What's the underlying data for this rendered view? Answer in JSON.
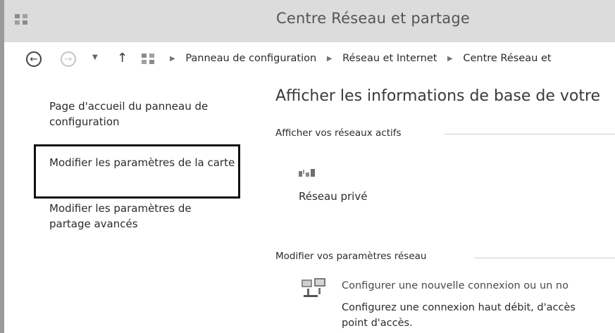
{
  "window": {
    "title": "Centre Réseau et partage"
  },
  "navbar": {
    "breadcrumb": [
      "Panneau de configuration",
      "Réseau et Internet",
      "Centre Réseau et"
    ]
  },
  "left_pane": {
    "links": [
      "Page d'accueil du panneau de configuration",
      "Modifier les paramètres de la carte",
      "Modifier les paramètres de partage avancés"
    ]
  },
  "main": {
    "heading": "Afficher les informations de base de votre",
    "active_networks": {
      "title": "Afficher vos réseaux actifs",
      "network_label": "Réseau privé"
    },
    "modify_settings": {
      "title": "Modifier vos paramètres réseau",
      "tasks": [
        {
          "label": "Configurer une nouvelle connexion ou un no",
          "description_line1": "Configurez une connexion haut débit, d'accès",
          "description_line2": "point d'accès."
        }
      ]
    }
  },
  "icons": {
    "title": "control-panel-icon",
    "back": "back-arrow-icon",
    "forward": "forward-arrow-icon",
    "up": "up-arrow-icon",
    "network": "network-icon",
    "new_connection": "new-connection-icon"
  },
  "colors": {
    "titlebar": "#dcdcdc",
    "highlight": "#111111"
  }
}
